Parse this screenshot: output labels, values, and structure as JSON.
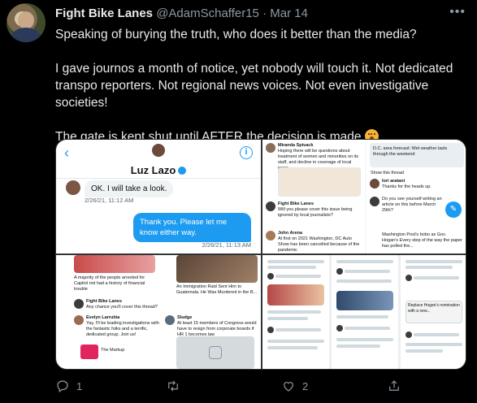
{
  "tweet": {
    "display_name": "Fight Bike Lanes",
    "handle": "@AdamSchaffer15",
    "separator": "·",
    "date": "Mar 14",
    "more_icon": "more-icon",
    "paragraphs": [
      "Speaking of burying the truth, who does it better than the media?",
      "I gave journos a month of notice, yet nobody will touch it. Not dedicated transpo reporters. Not regional news voices. Not even investigative societies!",
      "The gate is kept shut until AFTER the decision is made."
    ],
    "emoji_icon": "hushed-face-emoji"
  },
  "media": {
    "chat": {
      "contact_name": "Luz Lazo",
      "incoming_message": "OK. I will take a look.",
      "incoming_time": "2/26/21, 11:12 AM",
      "outgoing_message": "Thank you. Please let me know either way.",
      "outgoing_time": "2/26/21, 11:13 AM"
    },
    "panel2": {
      "t1_name": "Miranda Spivack",
      "t1_text": "Hoping there will be questions about treatment of women and minorities on its staff, and decline in coverage of local news.",
      "t2_name": "Fight Bike Lanes",
      "t2_text": "Will you please cover this issue being ignored by local journalists?",
      "t3_name": "John Arena",
      "t3_text": "At first on 2021 Washington, DC Auto Show has been cancelled because of the pandemic",
      "r1_text": "D.C. area forecast: Wet weather lasts through the weekend",
      "r2_name": "lori aratani",
      "r2_text": "Thanks for the heads up.",
      "r3_text": "Do you see yourself writing an article on this before March 29th?",
      "r4_text": "Washington Post's bobo as Gov. Hogan's Every step of the way the paper has polled the...",
      "show_thread": "Show this thread"
    },
    "panel3": {
      "headline1": "A majority of the people arrested for Capitol riot had a history of financial trouble",
      "headline2": "An Immigration Raid Sent Him to Guatemala. He Was Murdered in the B...",
      "t1_name": "Fight Bike Lanes",
      "t1_text": "Any chance you'll cover this thread?",
      "t2_name": "Evelyn Larrubia",
      "t2_text": "Yay, I'll be leading investigations with the fantastic folks and a terrific, dedicated group. Join us!",
      "badge": "The Markup",
      "t3_name": "Sludge",
      "t3_text": "At least 15 members of Congress would have to resign from corporate boards if HR 1 becomes law"
    },
    "panel4": {
      "caption": "Replace Hogan's nomination with a new..."
    }
  },
  "actions": {
    "reply_icon": "reply-icon",
    "reply_count": "1",
    "retweet_icon": "retweet-icon",
    "retweet_count": "",
    "like_icon": "heart-icon",
    "like_count": "2",
    "share_icon": "share-icon"
  },
  "colors": {
    "background": "#000000",
    "text": "#e7e9ea",
    "secondary": "#8b98a5",
    "accent": "#1d9bf0"
  }
}
